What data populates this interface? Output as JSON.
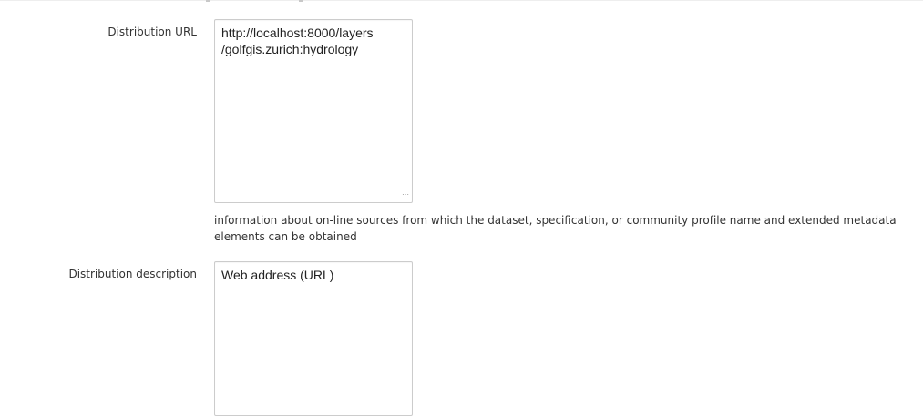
{
  "form": {
    "distribution_url": {
      "label": "Distribution URL",
      "value": "http://localhost:8000/layers\n/golfgis.zurich:hydrology",
      "help_text": "information about on-line sources from which the dataset, specification, or community profile name and extended metadata elements can be obtained"
    },
    "distribution_description": {
      "label": "Distribution description",
      "value": "Web address (URL)"
    }
  },
  "icons": {
    "resize_grip": "resize-grip-icon"
  },
  "colors": {
    "border": "#cccccc",
    "text": "#333333",
    "background": "#ffffff"
  }
}
